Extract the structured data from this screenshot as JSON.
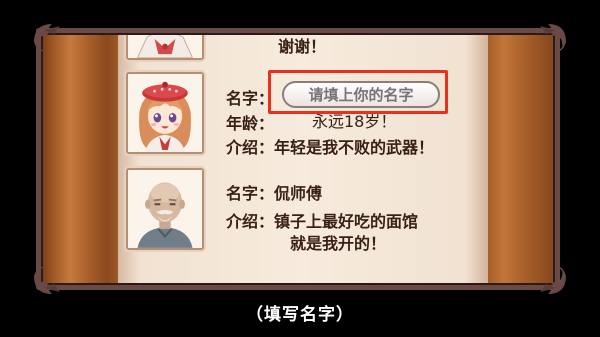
{
  "profiles": {
    "partial": {
      "intro_tail": "谢谢！"
    },
    "player": {
      "name_label": "名字：",
      "name_input": {
        "value": "",
        "placeholder": "请填上你的名字"
      },
      "age_label": "年龄：",
      "age_value": "永远18岁！",
      "intro_label": "介绍：",
      "intro_value": "年轻是我不败的武器！"
    },
    "chef": {
      "name_label": "名字：",
      "name_value": "侃师傅",
      "intro_label": "介绍：",
      "intro_line1": "镇子上最好吃的面馆",
      "intro_line2": "就是我开的！"
    }
  },
  "caption": "（填写名字）",
  "colors": {
    "highlight": "#e8301c",
    "text": "#3a1f16",
    "frame": "#6a4a47"
  },
  "icons": [
    "corner-ornament-icon",
    "corner-ornament-icon",
    "corner-ornament-icon",
    "corner-ornament-icon"
  ]
}
